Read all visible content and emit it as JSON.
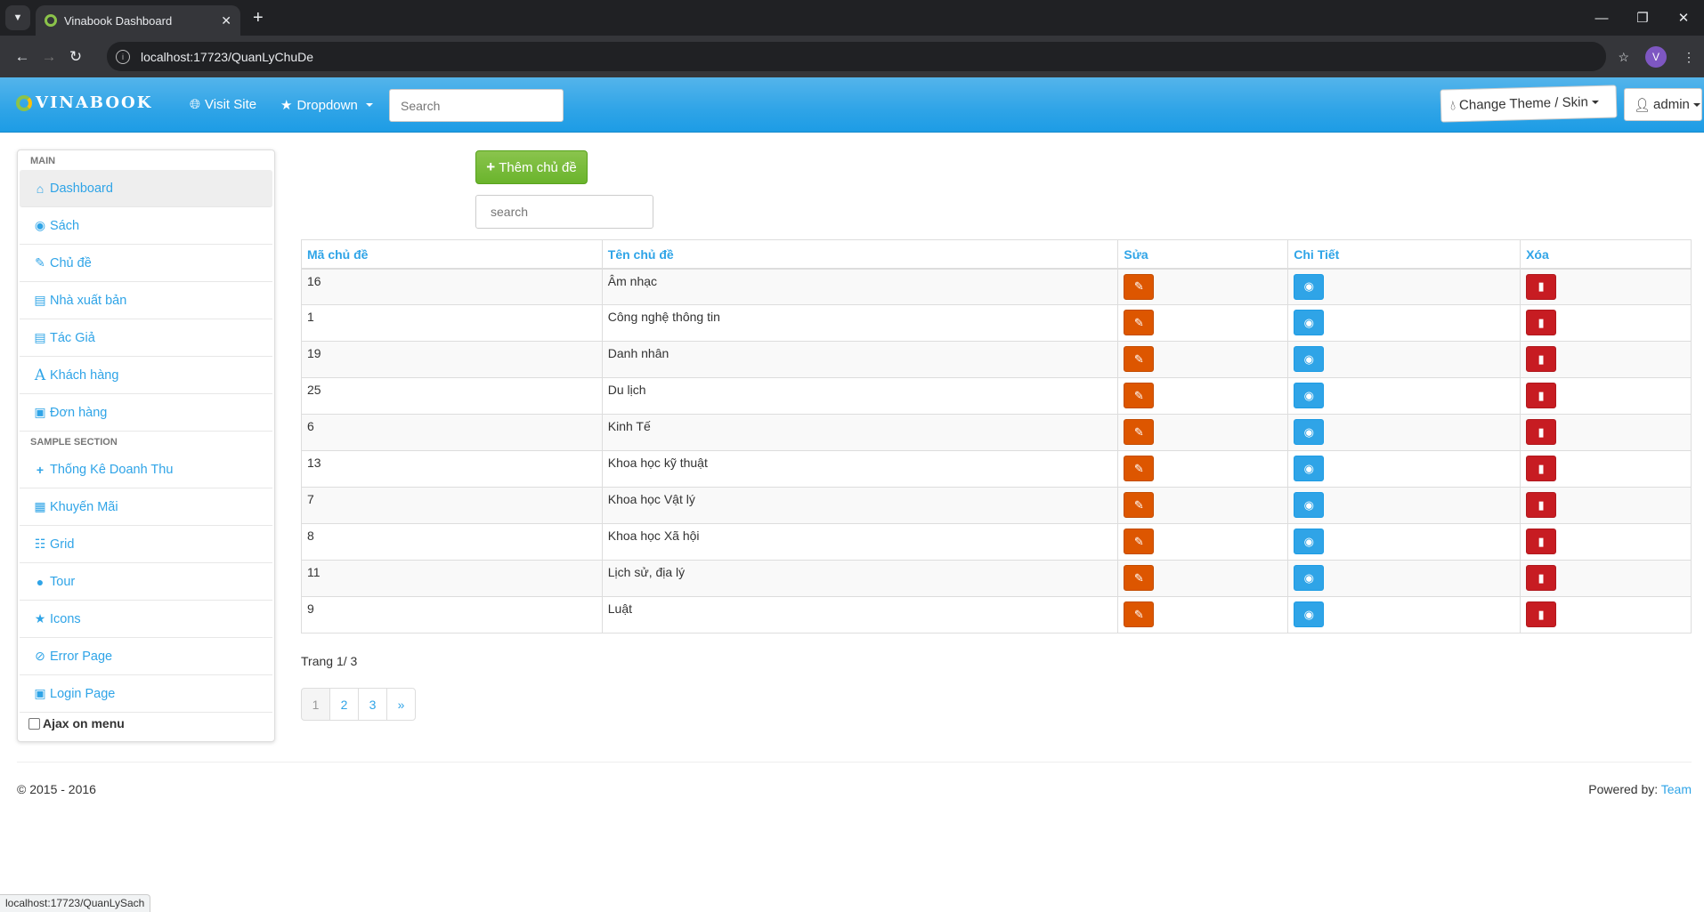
{
  "browser": {
    "tab_title": "Vinabook Dashboard",
    "url": "localhost:17723/QuanLyChuDe",
    "status_url": "localhost:17723/QuanLySach",
    "profile_initial": "V"
  },
  "navbar": {
    "brand": "VINABOOK",
    "visit_site": "Visit Site",
    "dropdown": "Dropdown",
    "search_placeholder": "Search",
    "theme_button": "Change Theme / Skin",
    "user_button": "admin"
  },
  "sidebar": {
    "main_header": "MAIN",
    "items": [
      {
        "label": "Dashboard",
        "icon": "home-icon"
      },
      {
        "label": "Sách",
        "icon": "eye-icon"
      },
      {
        "label": "Chủ đề",
        "icon": "edit-icon"
      },
      {
        "label": "Nhà xuất bản",
        "icon": "list-icon"
      },
      {
        "label": "Tác Giả",
        "icon": "list-icon"
      },
      {
        "label": "Khách hàng",
        "icon": "font-icon"
      },
      {
        "label": "Đơn hàng",
        "icon": "picture-icon"
      }
    ],
    "sample_header": "SAMPLE SECTION",
    "sample_items": [
      {
        "label": "Thống Kê Doanh Thu",
        "icon": "plus-icon"
      },
      {
        "label": "Khuyến Mãi",
        "icon": "calendar-icon"
      },
      {
        "label": "Grid",
        "icon": "grid-icon"
      },
      {
        "label": "Tour",
        "icon": "globe-icon"
      },
      {
        "label": "Icons",
        "icon": "star-icon"
      },
      {
        "label": "Error Page",
        "icon": "ban-icon"
      },
      {
        "label": "Login Page",
        "icon": "lock-icon"
      }
    ],
    "ajax_label": "Ajax on menu"
  },
  "main": {
    "add_button": "Thêm chủ đề",
    "search_placeholder": "search",
    "columns": [
      "Mã chủ đề",
      "Tên chủ đề",
      "Sửa",
      "Chi Tiết",
      "Xóa"
    ],
    "rows": [
      {
        "id": "16",
        "name": "Âm nhạc"
      },
      {
        "id": "1",
        "name": "Công nghệ thông tin"
      },
      {
        "id": "19",
        "name": "Danh nhân"
      },
      {
        "id": "25",
        "name": "Du lịch"
      },
      {
        "id": "6",
        "name": "Kinh Tế"
      },
      {
        "id": "13",
        "name": "Khoa học kỹ thuật"
      },
      {
        "id": "7",
        "name": "Khoa học Vật lý"
      },
      {
        "id": "8",
        "name": "Khoa học Xã hội"
      },
      {
        "id": "11",
        "name": "Lịch sử, địa lý"
      },
      {
        "id": "9",
        "name": "Luật"
      }
    ],
    "page_info": "Trang 1/ 3",
    "pages": [
      "1",
      "2",
      "3",
      "»"
    ]
  },
  "footer": {
    "copyright": "© 2015 - 2016",
    "powered_by": "Powered by:",
    "team": "Team"
  },
  "colors": {
    "primary": "#2fa4e7",
    "success": "#73a839",
    "warning": "#dd5600",
    "danger": "#c71c22"
  }
}
